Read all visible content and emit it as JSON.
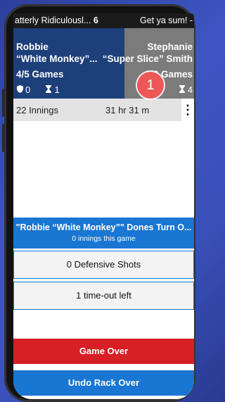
{
  "topbar": {
    "left_text": "atterly Ridiculousl...",
    "left_score": "6",
    "right_text": "Get ya sum! -"
  },
  "player1": {
    "name_line1": "Robbie",
    "name_line2": "“White Monkey”...",
    "games": "4/5 Games",
    "defense_count": "0",
    "timeout_count": "1"
  },
  "player2": {
    "name_line1": "Stephanie",
    "name_line2": "“Super Slice” Smith",
    "games": "0/2 Games",
    "defense_count": "1",
    "timeout_count": "4"
  },
  "innings_bar": {
    "innings": "22 Innings",
    "time": "31 hr 31 m"
  },
  "badge": {
    "number": "1"
  },
  "menu": {
    "icon": "⋮"
  },
  "turn_banner": {
    "title": "\"Robbie “White Monkey”\" Dones Turn O...",
    "subtitle": "0 innings this game"
  },
  "buttons": {
    "defensive_shots": "0 Defensive Shots",
    "timeouts": "1 time-out left",
    "game_over": "Game Over",
    "undo": "Undo Rack Over"
  },
  "colors": {
    "player1_bg": "#1d3f7a",
    "player2_bg": "#7b7b7b",
    "accent_blue": "#1976d2",
    "danger_red": "#d71f26",
    "badge_red": "#ee5757"
  }
}
